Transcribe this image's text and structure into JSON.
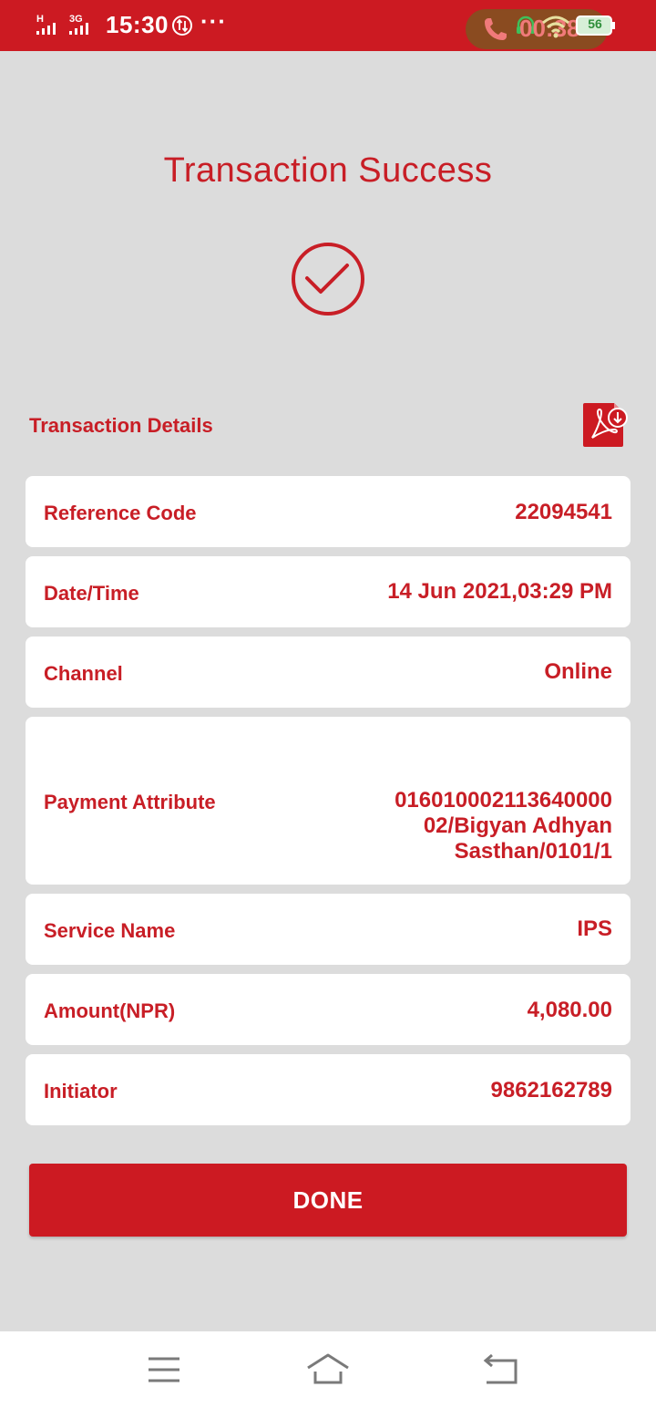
{
  "status_bar": {
    "network_h": "H",
    "network_3g": "3G",
    "time": "15:30",
    "call_timer": "00:38",
    "battery_level": "56",
    "colors": {
      "background": "#cc1a22",
      "call_pill": "#8a4b20",
      "battery": "#2f8f3b"
    }
  },
  "page": {
    "title": "Transaction Success",
    "icons": {
      "success": "check-circle-icon",
      "pdf": "pdf-download-icon"
    }
  },
  "details": {
    "heading": "Transaction Details",
    "rows": [
      {
        "label": "Reference Code",
        "value": "22094541"
      },
      {
        "label": "Date/Time",
        "value": "14 Jun 2021,03:29 PM"
      },
      {
        "label": "Channel",
        "value": "Online"
      },
      {
        "label": "Payment Attribute",
        "value": "016010002113640000\n02/Bigyan Adhyan\nSasthan/0101/1"
      },
      {
        "label": "Service Name",
        "value": "IPS"
      },
      {
        "label": "Amount(NPR)",
        "value": "4,080.00"
      },
      {
        "label": "Initiator",
        "value": "9862162789"
      }
    ]
  },
  "actions": {
    "done_label": "DONE"
  },
  "nav_bar": {
    "icons": [
      "menu-icon",
      "home-icon",
      "back-icon"
    ]
  },
  "colors": {
    "accent": "#cc1a22",
    "text_red": "#c81e26",
    "background": "#dcdcdc",
    "card": "#ffffff"
  }
}
